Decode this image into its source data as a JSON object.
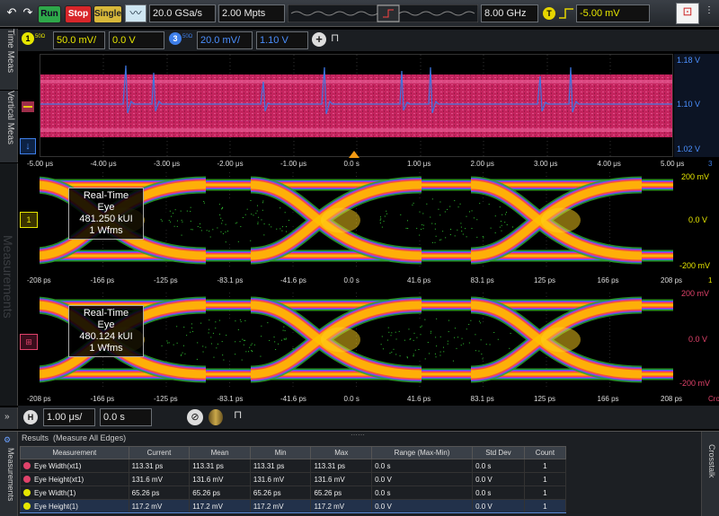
{
  "colors": {
    "ch1": "#e6e600",
    "ch3": "#3e7ee8",
    "ref": "#e0426a",
    "accent": "#4b90ff"
  },
  "toolbar": {
    "run_label": "Run",
    "stop_label": "Stop",
    "single_label": "Single",
    "sample_rate": "20.0 GSa/s",
    "memory_depth": "2.00 Mpts",
    "bandwidth": "8.00 GHz",
    "trigger_level": "-5.00 mV",
    "trigger_badge": "T"
  },
  "channels": [
    {
      "num": "1",
      "tag": "50Ω",
      "scale": "50.0 mV/",
      "offset": "0.0 V"
    },
    {
      "num": "3",
      "tag": "50Ω",
      "scale": "20.0 mV/",
      "offset": "1.10 V"
    }
  ],
  "side_tabs": {
    "time_meas": "Time Meas",
    "vertical_meas": "Vertical Meas",
    "measurements": "Measurements",
    "crosstalk": "Crosstalk"
  },
  "plot1": {
    "x_ticks": [
      "-5.00 μs",
      "-4.00 μs",
      "-3.00 μs",
      "-2.00 μs",
      "-1.00 μs",
      "0.0 s",
      "1.00 μs",
      "2.00 μs",
      "3.00 μs",
      "4.00 μs",
      "5.00 μs"
    ],
    "right_labels": [
      "1.18 V",
      "1.10 V",
      "1.02 V"
    ],
    "edge_marker": "3"
  },
  "eye1": {
    "title": "Real-Time Eye",
    "kui": "481.250 kUI",
    "wfms": "1 Wfms",
    "x_ticks": [
      "-208 ps",
      "-166 ps",
      "-125 ps",
      "-83.1 ps",
      "-41.6 ps",
      "0.0 s",
      "41.6 ps",
      "83.1 ps",
      "125 ps",
      "166 ps",
      "208 ps"
    ],
    "right_labels": [
      "200 mV",
      "0.0 V",
      "-200 mV"
    ],
    "edge_marker": "1"
  },
  "eye2": {
    "title": "Real-Time Eye",
    "kui": "480.124 kUI",
    "wfms": "1 Wfms",
    "x_ticks": [
      "-208 ps",
      "-166 ps",
      "-125 ps",
      "-83.1 ps",
      "-41.6 ps",
      "0.0 s",
      "41.6 ps",
      "83.1 ps",
      "125 ps",
      "166 ps",
      "208 ps"
    ],
    "right_labels": [
      "200 mV",
      "0.0 V",
      "-200 mV"
    ],
    "edge_marker": "Cro"
  },
  "horizontal": {
    "badge": "H",
    "scale": "1.00 μs/",
    "position": "0.0 s"
  },
  "results": {
    "title": "Results",
    "subtitle": "(Measure All Edges)",
    "columns": [
      "Measurement",
      "Current",
      "Mean",
      "Min",
      "Max",
      "Range (Max-Min)",
      "Std Dev",
      "Count"
    ],
    "rows": [
      {
        "color": "#e0426a",
        "name": "Eye Width(xt1)",
        "current": "113.31 ps",
        "mean": "113.31 ps",
        "min": "113.31 ps",
        "max": "113.31 ps",
        "range": "0.0 s",
        "std": "0.0 s",
        "count": "1"
      },
      {
        "color": "#e0426a",
        "name": "Eye Height(xt1)",
        "current": "131.6 mV",
        "mean": "131.6 mV",
        "min": "131.6 mV",
        "max": "131.6 mV",
        "range": "0.0 V",
        "std": "0.0 V",
        "count": "1"
      },
      {
        "color": "#e6e600",
        "name": "Eye Width(1)",
        "current": "65.26 ps",
        "mean": "65.26 ps",
        "min": "65.26 ps",
        "max": "65.26 ps",
        "range": "0.0 s",
        "std": "0.0 s",
        "count": "1"
      },
      {
        "color": "#e6e600",
        "name": "Eye Height(1)",
        "current": "117.2 mV",
        "mean": "117.2 mV",
        "min": "117.2 mV",
        "max": "117.2 mV",
        "range": "0.0 V",
        "std": "0.0 V",
        "count": "1"
      }
    ]
  }
}
